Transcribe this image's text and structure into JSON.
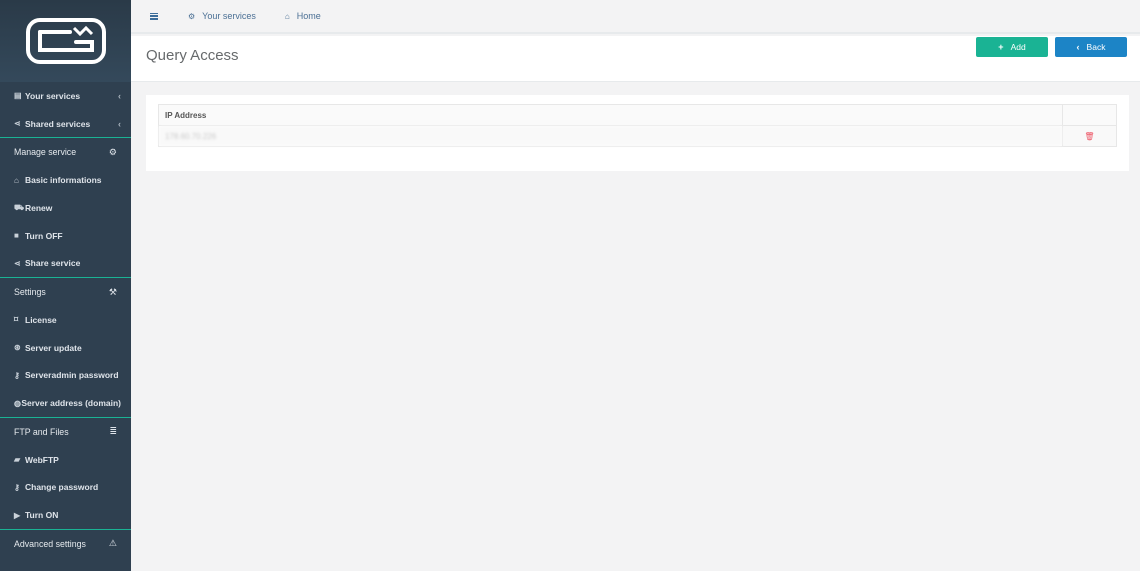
{
  "sidebar": {
    "items": [
      {
        "id": "your-services",
        "label": "Your services",
        "icon": "list-icon",
        "type": "item",
        "caret": true
      },
      {
        "id": "shared-services",
        "label": "Shared services",
        "icon": "share-icon",
        "type": "item",
        "caret": true
      },
      {
        "id": "manage-service",
        "label": "Manage service",
        "icon": "cogs-icon",
        "type": "section"
      },
      {
        "id": "basic-informations",
        "label": "Basic informations",
        "icon": "home-icon",
        "type": "item"
      },
      {
        "id": "renew",
        "label": "Renew",
        "icon": "cart-icon",
        "type": "item"
      },
      {
        "id": "turn-off",
        "label": "Turn OFF",
        "icon": "stop-icon",
        "type": "item"
      },
      {
        "id": "share-service",
        "label": "Share service",
        "icon": "share-icon",
        "type": "item"
      },
      {
        "id": "settings",
        "label": "Settings",
        "icon": "wrench-icon",
        "type": "section"
      },
      {
        "id": "license",
        "label": "License",
        "icon": "bookmark-icon",
        "type": "item"
      },
      {
        "id": "server-update",
        "label": "Server update",
        "icon": "update-icon",
        "type": "item"
      },
      {
        "id": "serveradmin-password",
        "label": "Serveradmin password",
        "icon": "key-icon",
        "type": "item"
      },
      {
        "id": "server-address",
        "label": "Server address (domain)",
        "icon": "globe-icon",
        "type": "item"
      },
      {
        "id": "ftp-and-files",
        "label": "FTP and Files",
        "icon": "database-icon",
        "type": "section"
      },
      {
        "id": "webftp",
        "label": "WebFTP",
        "icon": "folder-icon",
        "type": "item"
      },
      {
        "id": "change-password",
        "label": "Change password",
        "icon": "key-icon",
        "type": "item"
      },
      {
        "id": "turn-on",
        "label": "Turn ON",
        "icon": "play-icon",
        "type": "item"
      },
      {
        "id": "advanced-settings",
        "label": "Advanced settings",
        "icon": "warning-icon",
        "type": "section"
      }
    ]
  },
  "topbar": {
    "your_services": "Your services",
    "home": "Home"
  },
  "page": {
    "title": "Query Access",
    "add_label": "Add",
    "back_label": "Back"
  },
  "table": {
    "header_ip": "IP Address",
    "rows": [
      {
        "ip": "178.60.70.226"
      }
    ]
  },
  "colors": {
    "sidebar_bg": "#2f4050",
    "accent_green": "#1ab394",
    "accent_blue": "#1c84c6",
    "danger_red": "#ed5565"
  }
}
